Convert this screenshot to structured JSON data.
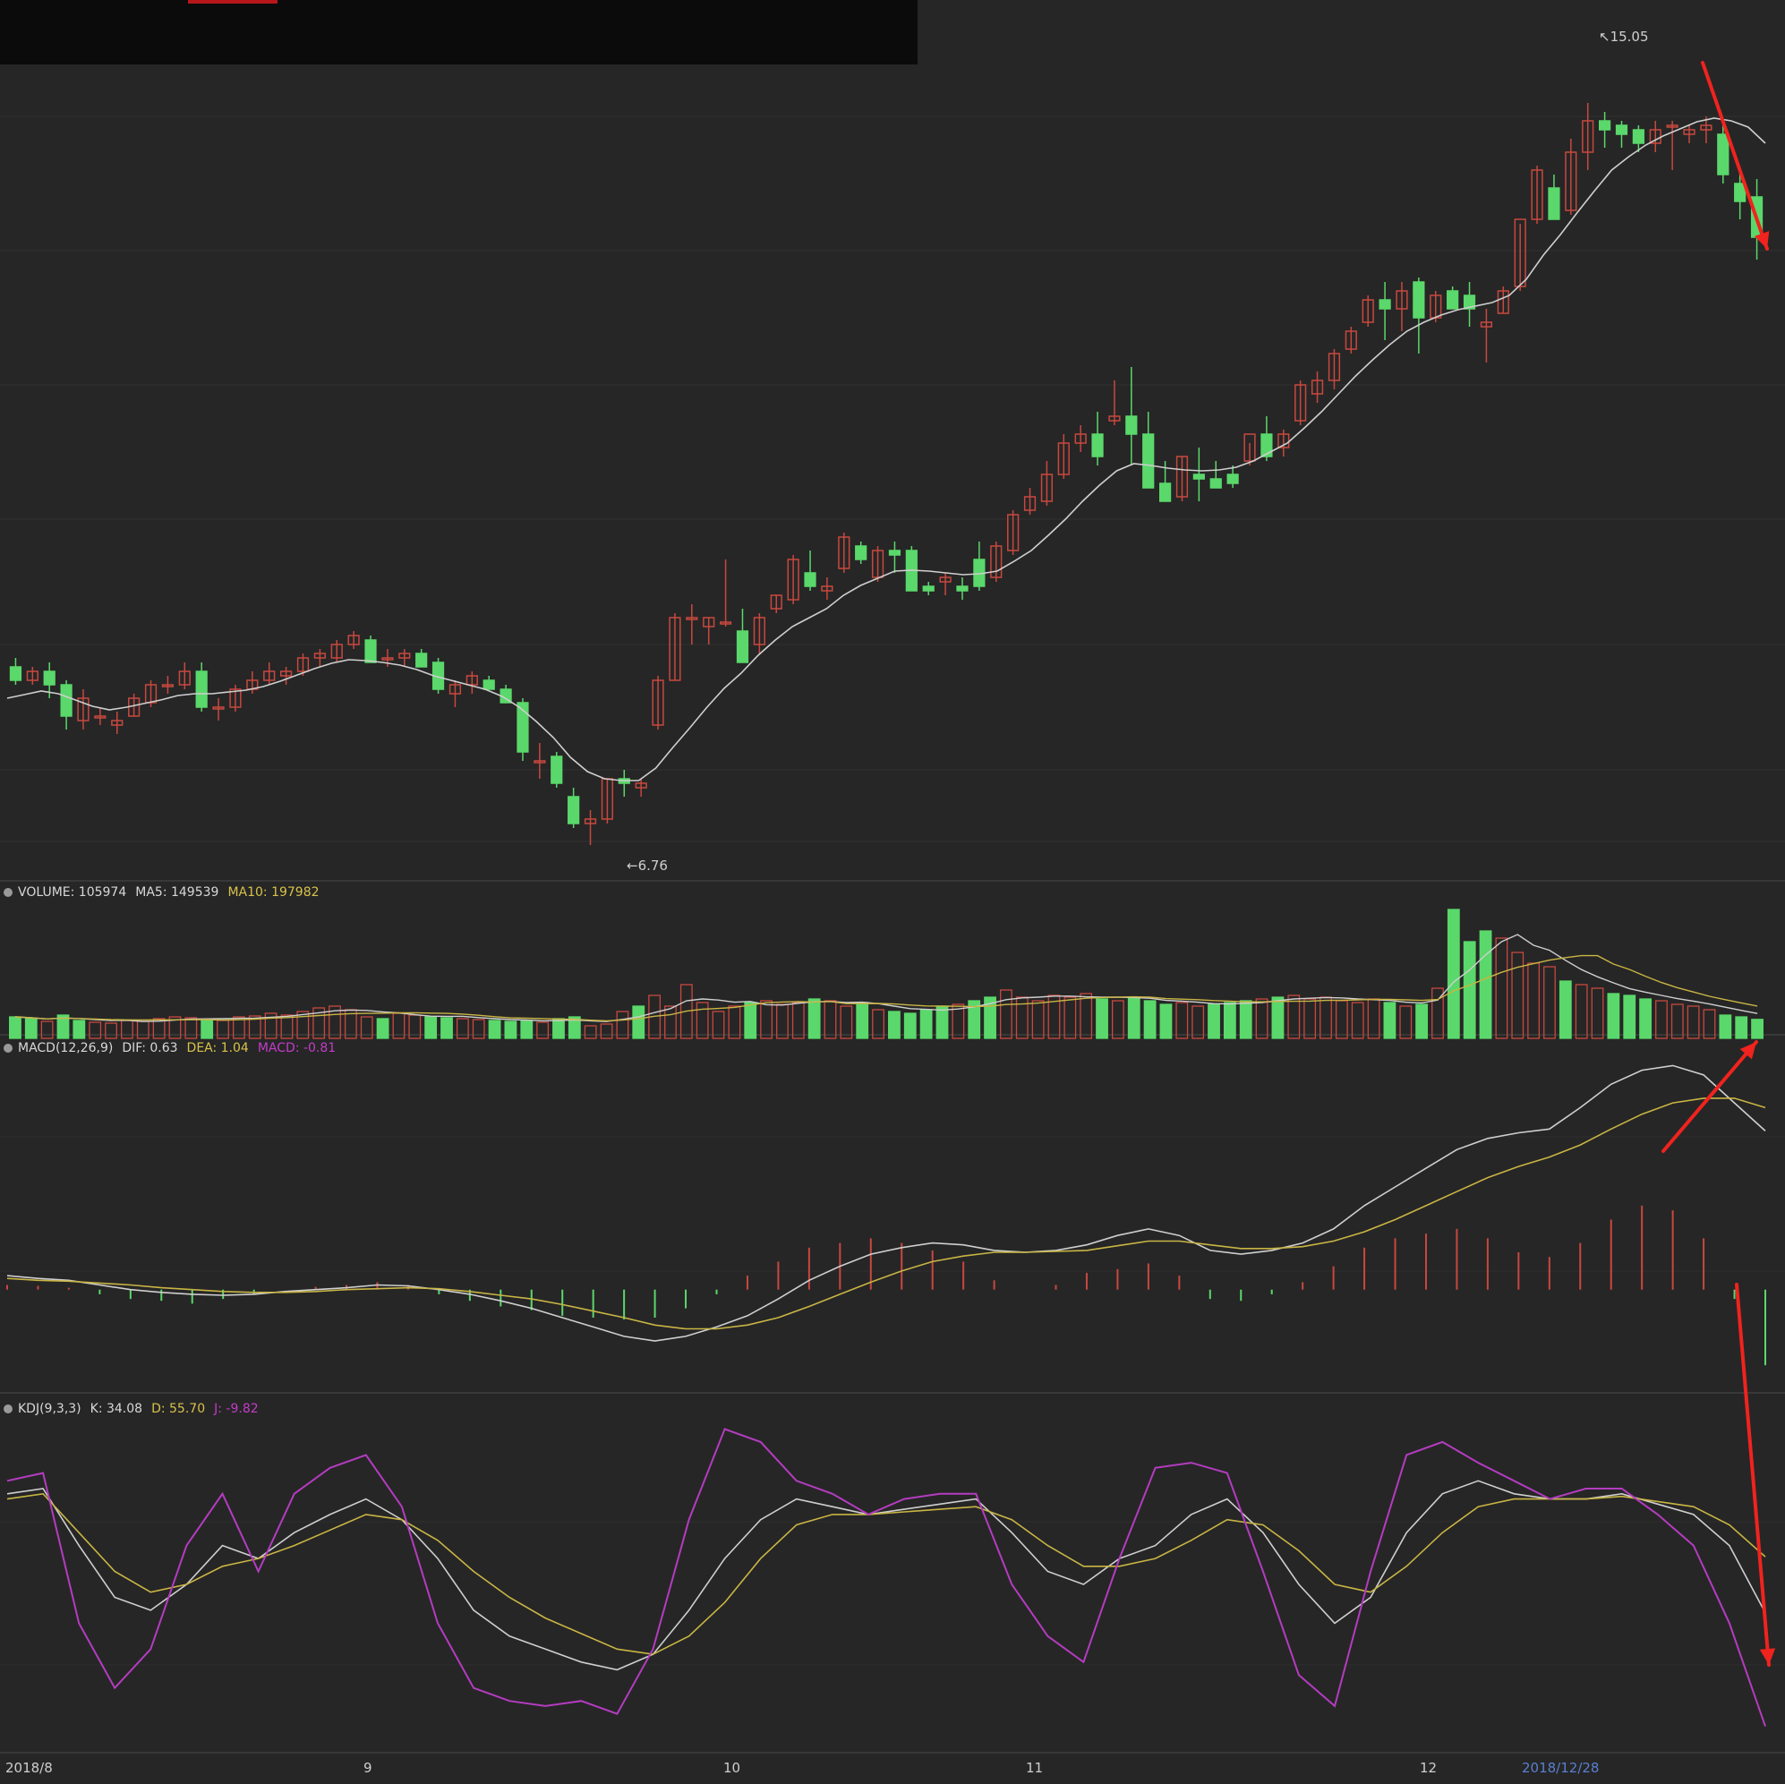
{
  "header": {
    "title": ""
  },
  "price_labels": {
    "high": "15.05",
    "low": "6.76"
  },
  "volume_legend": {
    "name": "VOLUME: 105974",
    "ma5": "MA5: 149539",
    "ma10": "MA10: 197982"
  },
  "macd_legend": {
    "name": "MACD(12,26,9)",
    "dif": "DIF: 0.63",
    "dea": "DEA: 1.04",
    "macd": "MACD: -0.81"
  },
  "kdj_legend": {
    "name": "KDJ(9,3,3)",
    "k": "K: 34.08",
    "d": "D: 55.70",
    "j": "J: -9.82"
  },
  "x_axis": {
    "labels": [
      "2018/8",
      "9",
      "10",
      "11",
      "12",
      "2018/12/28"
    ]
  },
  "colors": {
    "up": "#c8483f",
    "down": "#5bd86b",
    "ma": "#cfcfcf",
    "ma10": "#c9b544",
    "j_line": "#b43cc0",
    "arrow": "#f0231e"
  },
  "chart_data": [
    {
      "type": "candlestick",
      "title": "",
      "ylim": [
        6.5,
        15.5
      ],
      "max_label": 15.05,
      "min_label": 6.76,
      "candles_ohlc": [
        [
          8.75,
          8.85,
          8.55,
          8.6
        ],
        [
          8.6,
          8.75,
          8.55,
          8.7
        ],
        [
          8.7,
          8.8,
          8.4,
          8.55
        ],
        [
          8.55,
          8.6,
          8.05,
          8.2
        ],
        [
          8.15,
          8.5,
          8.05,
          8.4
        ],
        [
          8.2,
          8.3,
          8.1,
          8.2
        ],
        [
          8.1,
          8.25,
          8.0,
          8.15
        ],
        [
          8.2,
          8.45,
          8.2,
          8.4
        ],
        [
          8.35,
          8.6,
          8.3,
          8.55
        ],
        [
          8.55,
          8.65,
          8.45,
          8.55
        ],
        [
          8.55,
          8.8,
          8.5,
          8.7
        ],
        [
          8.7,
          8.8,
          8.25,
          8.3
        ],
        [
          8.3,
          8.4,
          8.15,
          8.3
        ],
        [
          8.3,
          8.55,
          8.25,
          8.5
        ],
        [
          8.5,
          8.7,
          8.45,
          8.6
        ],
        [
          8.6,
          8.8,
          8.55,
          8.7
        ],
        [
          8.65,
          8.75,
          8.55,
          8.7
        ],
        [
          8.7,
          8.9,
          8.65,
          8.85
        ],
        [
          8.85,
          8.95,
          8.75,
          8.9
        ],
        [
          8.85,
          9.05,
          8.8,
          9.0
        ],
        [
          9.0,
          9.15,
          8.95,
          9.1
        ],
        [
          9.05,
          9.1,
          8.85,
          8.8
        ],
        [
          8.85,
          8.95,
          8.75,
          8.85
        ],
        [
          8.85,
          8.95,
          8.75,
          8.9
        ],
        [
          8.9,
          8.95,
          8.75,
          8.75
        ],
        [
          8.8,
          8.85,
          8.45,
          8.5
        ],
        [
          8.45,
          8.6,
          8.3,
          8.55
        ],
        [
          8.55,
          8.7,
          8.45,
          8.65
        ],
        [
          8.6,
          8.65,
          8.5,
          8.5
        ],
        [
          8.5,
          8.55,
          8.35,
          8.35
        ],
        [
          8.35,
          8.4,
          7.7,
          7.8
        ],
        [
          7.7,
          7.9,
          7.5,
          7.7
        ],
        [
          7.75,
          7.8,
          7.4,
          7.45
        ],
        [
          7.3,
          7.4,
          6.95,
          7.0
        ],
        [
          7.0,
          7.15,
          6.76,
          7.05
        ],
        [
          7.05,
          7.5,
          7.0,
          7.5
        ],
        [
          7.5,
          7.6,
          7.3,
          7.45
        ],
        [
          7.4,
          7.5,
          7.3,
          7.45
        ],
        [
          8.1,
          8.65,
          8.05,
          8.6
        ],
        [
          8.6,
          9.35,
          8.6,
          9.3
        ],
        [
          9.3,
          9.45,
          9.0,
          9.3
        ],
        [
          9.2,
          9.3,
          9.0,
          9.3
        ],
        [
          9.25,
          9.95,
          9.2,
          9.25
        ],
        [
          9.15,
          9.4,
          8.8,
          8.8
        ],
        [
          9.0,
          9.35,
          8.9,
          9.3
        ],
        [
          9.4,
          9.55,
          9.35,
          9.55
        ],
        [
          9.5,
          10.0,
          9.45,
          9.95
        ],
        [
          9.8,
          10.05,
          9.6,
          9.65
        ],
        [
          9.6,
          9.75,
          9.5,
          9.65
        ],
        [
          9.85,
          10.25,
          9.8,
          10.2
        ],
        [
          10.1,
          10.15,
          9.9,
          9.95
        ],
        [
          9.75,
          10.1,
          9.7,
          10.05
        ],
        [
          10.05,
          10.15,
          9.8,
          10.0
        ],
        [
          10.05,
          10.1,
          9.65,
          9.6
        ],
        [
          9.65,
          9.7,
          9.55,
          9.6
        ],
        [
          9.7,
          9.8,
          9.55,
          9.75
        ],
        [
          9.65,
          9.75,
          9.5,
          9.6
        ],
        [
          9.95,
          10.15,
          9.6,
          9.65
        ],
        [
          9.75,
          10.15,
          9.7,
          10.1
        ],
        [
          10.05,
          10.5,
          10.0,
          10.45
        ],
        [
          10.5,
          10.75,
          10.45,
          10.65
        ],
        [
          10.6,
          11.05,
          10.55,
          10.9
        ],
        [
          10.9,
          11.35,
          10.85,
          11.25
        ],
        [
          11.25,
          11.45,
          11.15,
          11.35
        ],
        [
          11.35,
          11.6,
          11.0,
          11.1
        ],
        [
          11.5,
          11.95,
          11.45,
          11.55
        ],
        [
          11.55,
          12.1,
          11.0,
          11.35
        ],
        [
          11.35,
          11.6,
          11.2,
          10.75
        ],
        [
          10.8,
          11.05,
          10.6,
          10.6
        ],
        [
          10.65,
          11.1,
          10.6,
          11.1
        ],
        [
          10.9,
          11.2,
          10.6,
          10.85
        ],
        [
          10.85,
          11.05,
          10.75,
          10.75
        ],
        [
          10.9,
          11.0,
          10.75,
          10.8
        ],
        [
          11.05,
          11.25,
          11.0,
          11.35
        ],
        [
          11.35,
          11.55,
          11.05,
          11.1
        ],
        [
          11.2,
          11.4,
          11.1,
          11.35
        ],
        [
          11.5,
          11.95,
          11.45,
          11.9
        ],
        [
          11.8,
          12.05,
          11.7,
          11.95
        ],
        [
          11.95,
          12.3,
          11.85,
          12.25
        ],
        [
          12.3,
          12.55,
          12.25,
          12.5
        ],
        [
          12.6,
          12.9,
          12.55,
          12.85
        ],
        [
          12.85,
          13.05,
          12.4,
          12.75
        ],
        [
          12.75,
          13.05,
          12.5,
          12.95
        ],
        [
          13.05,
          13.1,
          12.25,
          12.65
        ],
        [
          12.65,
          12.95,
          12.6,
          12.9
        ],
        [
          12.95,
          13.0,
          12.8,
          12.75
        ],
        [
          12.9,
          13.05,
          12.55,
          12.75
        ],
        [
          12.55,
          12.75,
          12.15,
          12.6
        ],
        [
          12.7,
          13.0,
          12.7,
          12.95
        ],
        [
          13.0,
          13.7,
          12.95,
          13.75
        ],
        [
          13.75,
          14.35,
          13.7,
          14.3
        ],
        [
          14.1,
          14.25,
          13.75,
          13.75
        ],
        [
          13.85,
          14.65,
          13.8,
          14.5
        ],
        [
          14.5,
          15.05,
          14.3,
          14.85
        ],
        [
          14.85,
          14.95,
          14.55,
          14.75
        ],
        [
          14.8,
          14.85,
          14.55,
          14.7
        ],
        [
          14.75,
          14.8,
          14.5,
          14.6
        ],
        [
          14.6,
          14.85,
          14.5,
          14.75
        ],
        [
          14.8,
          14.85,
          14.3,
          14.8
        ],
        [
          14.7,
          14.8,
          14.6,
          14.75
        ],
        [
          14.75,
          14.9,
          14.6,
          14.8
        ],
        [
          14.7,
          14.85,
          14.15,
          14.25
        ],
        [
          14.15,
          14.3,
          13.75,
          13.95
        ],
        [
          14.0,
          14.2,
          13.3,
          13.55
        ]
      ],
      "ma": [
        8.4,
        8.44,
        8.48,
        8.45,
        8.38,
        8.31,
        8.27,
        8.3,
        8.34,
        8.38,
        8.43,
        8.45,
        8.45,
        8.47,
        8.49,
        8.53,
        8.59,
        8.66,
        8.73,
        8.79,
        8.83,
        8.82,
        8.8,
        8.77,
        8.72,
        8.65,
        8.6,
        8.55,
        8.5,
        8.42,
        8.3,
        8.14,
        7.96,
        7.74,
        7.58,
        7.5,
        7.48,
        7.48,
        7.62,
        7.85,
        8.07,
        8.3,
        8.51,
        8.68,
        8.88,
        9.05,
        9.2,
        9.3,
        9.4,
        9.55,
        9.66,
        9.74,
        9.82,
        9.83,
        9.82,
        9.8,
        9.78,
        9.79,
        9.82,
        9.93,
        10.05,
        10.22,
        10.4,
        10.6,
        10.78,
        10.94,
        11.02,
        11.0,
        10.97,
        10.95,
        10.94,
        10.95,
        10.98,
        11.05,
        11.15,
        11.25,
        11.42,
        11.6,
        11.8,
        12.0,
        12.18,
        12.35,
        12.5,
        12.6,
        12.68,
        12.74,
        12.78,
        12.82,
        12.9,
        13.08,
        13.35,
        13.58,
        13.83,
        14.07,
        14.3,
        14.45,
        14.58,
        14.68,
        14.76,
        14.84,
        14.88,
        14.85,
        14.78,
        14.6
      ]
    },
    {
      "type": "bar",
      "title": "VOLUME",
      "ylim": [
        0,
        800000
      ],
      "values": [
        120000,
        110000,
        95000,
        130000,
        100000,
        90000,
        85000,
        100000,
        95000,
        110000,
        120000,
        115000,
        105000,
        100000,
        120000,
        125000,
        140000,
        130000,
        150000,
        170000,
        180000,
        160000,
        120000,
        110000,
        140000,
        130000,
        120000,
        115000,
        110000,
        105000,
        100000,
        95000,
        100000,
        90000,
        110000,
        120000,
        70000,
        80000,
        150000,
        180000,
        240000,
        180000,
        300000,
        200000,
        150000,
        180000,
        200000,
        210000,
        190000,
        200000,
        220000,
        210000,
        180000,
        200000,
        160000,
        150000,
        140000,
        160000,
        180000,
        190000,
        210000,
        230000,
        270000,
        230000,
        210000,
        240000,
        230000,
        250000,
        220000,
        210000,
        230000,
        210000,
        190000,
        200000,
        180000,
        190000,
        200000,
        210000,
        220000,
        230000,
        240000,
        220000,
        230000,
        210000,
        200000,
        220000,
        200000,
        180000,
        190000,
        280000,
        720000,
        540000,
        600000,
        560000,
        480000,
        420000,
        400000,
        320000,
        300000,
        280000,
        250000,
        240000,
        220000,
        210000,
        190000,
        180000,
        160000,
        130000,
        120000,
        106000
      ]
    },
    {
      "type": "line",
      "title": "MACD(12,26,9)",
      "ylim": [
        -1.0,
        2.5
      ],
      "series": [
        {
          "name": "DIF",
          "values": [
            0.15,
            0.12,
            0.1,
            0.05,
            0.0,
            -0.03,
            -0.05,
            -0.06,
            -0.05,
            -0.02,
            0.0,
            0.02,
            0.05,
            0.04,
            0.0,
            -0.05,
            -0.12,
            -0.2,
            -0.3,
            -0.4,
            -0.5,
            -0.55,
            -0.5,
            -0.4,
            -0.28,
            -0.1,
            0.1,
            0.25,
            0.38,
            0.45,
            0.5,
            0.48,
            0.42,
            0.4,
            0.42,
            0.48,
            0.58,
            0.65,
            0.58,
            0.42,
            0.38,
            0.42,
            0.5,
            0.65,
            0.9,
            1.1,
            1.3,
            1.5,
            1.62,
            1.68,
            1.72,
            1.95,
            2.2,
            2.35,
            2.4,
            2.3,
            2.0,
            1.7
          ]
        },
        {
          "name": "DEA",
          "values": [
            0.12,
            0.1,
            0.09,
            0.07,
            0.05,
            0.02,
            0.0,
            -0.02,
            -0.03,
            -0.03,
            -0.02,
            0.0,
            0.01,
            0.02,
            0.01,
            -0.02,
            -0.06,
            -0.1,
            -0.16,
            -0.23,
            -0.3,
            -0.38,
            -0.42,
            -0.42,
            -0.38,
            -0.3,
            -0.18,
            -0.05,
            0.08,
            0.2,
            0.3,
            0.36,
            0.4,
            0.4,
            0.41,
            0.42,
            0.47,
            0.52,
            0.52,
            0.48,
            0.44,
            0.44,
            0.46,
            0.52,
            0.62,
            0.75,
            0.9,
            1.05,
            1.2,
            1.32,
            1.42,
            1.55,
            1.72,
            1.88,
            2.0,
            2.05,
            2.05,
            1.95
          ]
        },
        {
          "name": "MACD",
          "values": [
            0.05,
            0.04,
            0.02,
            -0.05,
            -0.1,
            -0.12,
            -0.15,
            -0.1,
            -0.05,
            0.0,
            0.03,
            0.05,
            0.08,
            0.05,
            -0.05,
            -0.12,
            -0.18,
            -0.22,
            -0.28,
            -0.3,
            -0.32,
            -0.3,
            -0.2,
            -0.05,
            0.15,
            0.3,
            0.45,
            0.5,
            0.55,
            0.5,
            0.42,
            0.3,
            0.1,
            0.0,
            0.05,
            0.18,
            0.22,
            0.28,
            0.15,
            -0.1,
            -0.12,
            -0.05,
            0.08,
            0.25,
            0.45,
            0.55,
            0.6,
            0.65,
            0.55,
            0.4,
            0.35,
            0.5,
            0.75,
            0.9,
            0.85,
            0.55,
            -0.1,
            -0.81
          ]
        }
      ]
    },
    {
      "type": "line",
      "title": "KDJ(9,3,3)",
      "ylim": [
        -20,
        110
      ],
      "series": [
        {
          "name": "K",
          "values": [
            80,
            82,
            60,
            40,
            35,
            45,
            60,
            55,
            65,
            72,
            78,
            70,
            55,
            35,
            25,
            20,
            15,
            12,
            18,
            35,
            55,
            70,
            78,
            75,
            72,
            74,
            76,
            78,
            65,
            50,
            45,
            55,
            60,
            72,
            78,
            65,
            45,
            30,
            40,
            65,
            80,
            85,
            80,
            78,
            78,
            80,
            76,
            72,
            60,
            34
          ]
        },
        {
          "name": "D",
          "values": [
            78,
            80,
            65,
            50,
            42,
            45,
            52,
            55,
            60,
            66,
            72,
            70,
            62,
            50,
            40,
            32,
            26,
            20,
            18,
            25,
            38,
            55,
            68,
            72,
            72,
            73,
            74,
            75,
            70,
            60,
            52,
            52,
            55,
            62,
            70,
            68,
            58,
            45,
            42,
            52,
            65,
            75,
            78,
            78,
            78,
            79,
            77,
            75,
            68,
            55.7
          ]
        },
        {
          "name": "J",
          "values": [
            85,
            88,
            30,
            5,
            20,
            60,
            80,
            50,
            80,
            90,
            95,
            75,
            30,
            5,
            0,
            -2,
            0,
            -5,
            20,
            70,
            105,
            100,
            85,
            80,
            72,
            78,
            80,
            80,
            45,
            25,
            15,
            55,
            90,
            92,
            88,
            50,
            10,
            -2,
            50,
            95,
            100,
            92,
            85,
            78,
            82,
            82,
            72,
            60,
            30,
            -9.82
          ]
        }
      ]
    }
  ]
}
